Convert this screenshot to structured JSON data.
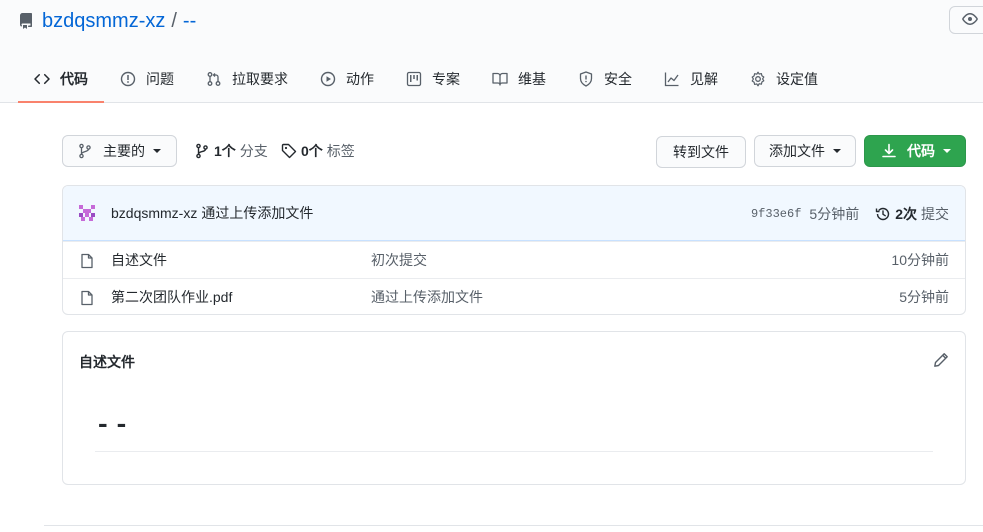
{
  "repo": {
    "owner": "bzdqsmmz-xz",
    "separator": "/",
    "name": "--"
  },
  "tabs": [
    {
      "label": "代码",
      "icon": "code-icon",
      "active": true
    },
    {
      "label": "问题",
      "icon": "issue-opened-icon"
    },
    {
      "label": "拉取要求",
      "icon": "pull-request-icon"
    },
    {
      "label": "动作",
      "icon": "play-icon"
    },
    {
      "label": "专案",
      "icon": "project-icon"
    },
    {
      "label": "维基",
      "icon": "book-icon"
    },
    {
      "label": "安全",
      "icon": "shield-icon"
    },
    {
      "label": "见解",
      "icon": "graph-icon"
    },
    {
      "label": "设定值",
      "icon": "gear-icon"
    }
  ],
  "toolbar": {
    "branch_label": "主要的",
    "branches_count": "1个",
    "branches_label": "分支",
    "tags_count": "0个",
    "tags_label": "标签",
    "goto_file": "转到文件",
    "add_file": "添加文件",
    "code_button": "代码"
  },
  "commit": {
    "author": "bzdqsmmz-xz",
    "message": "通过上传添加文件",
    "sha": "9f33e6f",
    "time": "5分钟前",
    "history_count": "2次",
    "history_label": "提交"
  },
  "files": [
    {
      "name": "自述文件",
      "message": "初次提交",
      "age": "10分钟前"
    },
    {
      "name": "第二次团队作业.pdf",
      "message": "通过上传添加文件",
      "age": "5分钟前"
    }
  ],
  "readme": {
    "title": "自述文件",
    "heading": "--"
  },
  "colors": {
    "link": "#0366d6",
    "accent_tab": "#f9826c",
    "green_button": "#2ea44f",
    "commit_bar": "#f1f8ff"
  }
}
